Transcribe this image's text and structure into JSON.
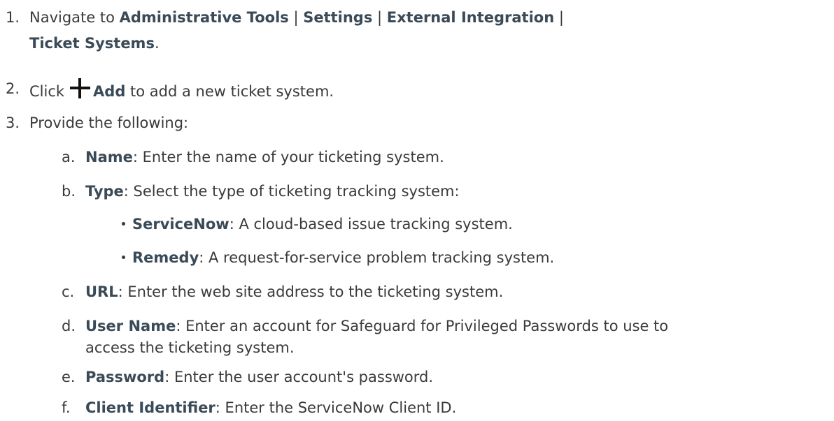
{
  "step1": {
    "number": "1.",
    "prefix": "Navigate to ",
    "path1": "Administrative Tools",
    "sep1": " | ",
    "path2": "Settings",
    "sep2": " | ",
    "path3": "External Integration",
    "sep3": " |",
    "path4": "Ticket Systems",
    "suffix": "."
  },
  "step2": {
    "number": "2.",
    "prefix": "Click",
    "icon": "plus-icon",
    "action": "Add",
    "suffix": " to add a new ticket system."
  },
  "step3": {
    "number": "3.",
    "text": "Provide the following:",
    "items": [
      {
        "letter": "a.",
        "term": "Name",
        "desc": ": Enter the name of your ticketing system."
      },
      {
        "letter": "b.",
        "term": "Type",
        "desc": ": Select the type of ticketing tracking system:"
      },
      {
        "letter": "c.",
        "term": "URL",
        "desc": ": Enter the web site address to the ticketing system."
      },
      {
        "letter": "d.",
        "term": "User Name",
        "desc": ": Enter an account for Safeguard for Privileged Passwords to use to",
        "desc_line2": "access the ticketing system."
      },
      {
        "letter": "e.",
        "term": "Password",
        "desc": ": Enter the user account's password."
      },
      {
        "letter": "f.",
        "term": "Client Identifier",
        "desc": ": Enter the ServiceNow Client ID."
      }
    ],
    "types": [
      {
        "term": "ServiceNow",
        "desc": ": A cloud-based issue tracking system."
      },
      {
        "term": "Remedy",
        "desc": ": A request-for-service problem tracking system."
      }
    ]
  }
}
